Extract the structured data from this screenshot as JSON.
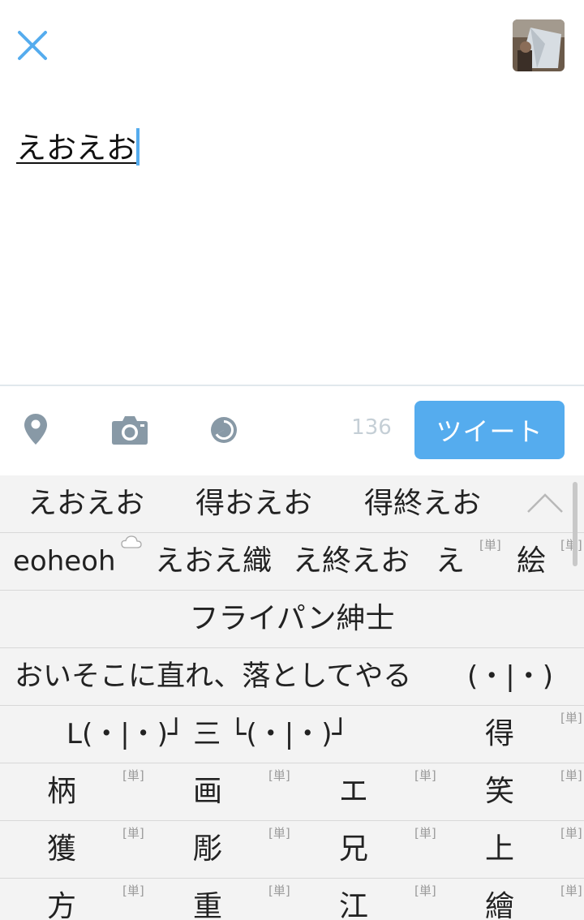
{
  "compose": {
    "draft_text": "えおえお",
    "char_count": "136",
    "tweet_label": "ツイート"
  },
  "colors": {
    "accent": "#55acee",
    "icon_gray": "#8899a6",
    "keyboard_bg": "#f3f3f3"
  },
  "icons": [
    "close-icon",
    "avatar",
    "location-pin-icon",
    "camera-icon",
    "poll-icon",
    "cloud-icon",
    "chevron-up-icon"
  ],
  "ime": {
    "suggestions": [
      "えおえお",
      "得おえお",
      "得終えお"
    ],
    "tag_label": "[単]",
    "row2": [
      "eoheoh",
      "えおえ織",
      "え終えお",
      "え",
      "絵"
    ],
    "row3": "フライパン紳士",
    "row4": [
      "おいそこに直れ、落としてやる",
      "(・|・)"
    ],
    "row5": [
      "L(・|・)┘ 三 └(・|・)┘",
      "得"
    ],
    "grid": [
      [
        "柄",
        "画",
        "エ",
        "笑"
      ],
      [
        "獲",
        "彫",
        "兄",
        "上"
      ],
      [
        "方",
        "重",
        "江",
        "繪"
      ]
    ]
  }
}
